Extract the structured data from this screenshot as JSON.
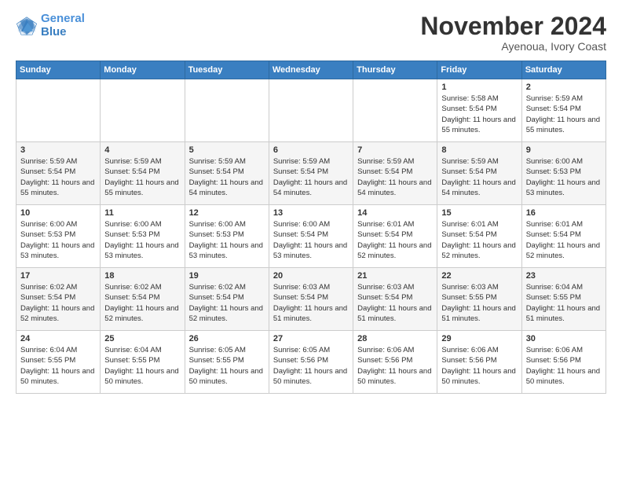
{
  "logo": {
    "line1": "General",
    "line2": "Blue"
  },
  "header": {
    "month": "November 2024",
    "location": "Ayenoua, Ivory Coast"
  },
  "weekdays": [
    "Sunday",
    "Monday",
    "Tuesday",
    "Wednesday",
    "Thursday",
    "Friday",
    "Saturday"
  ],
  "weeks": [
    [
      {
        "day": "",
        "info": ""
      },
      {
        "day": "",
        "info": ""
      },
      {
        "day": "",
        "info": ""
      },
      {
        "day": "",
        "info": ""
      },
      {
        "day": "",
        "info": ""
      },
      {
        "day": "1",
        "info": "Sunrise: 5:58 AM\nSunset: 5:54 PM\nDaylight: 11 hours and 55 minutes."
      },
      {
        "day": "2",
        "info": "Sunrise: 5:59 AM\nSunset: 5:54 PM\nDaylight: 11 hours and 55 minutes."
      }
    ],
    [
      {
        "day": "3",
        "info": "Sunrise: 5:59 AM\nSunset: 5:54 PM\nDaylight: 11 hours and 55 minutes."
      },
      {
        "day": "4",
        "info": "Sunrise: 5:59 AM\nSunset: 5:54 PM\nDaylight: 11 hours and 55 minutes."
      },
      {
        "day": "5",
        "info": "Sunrise: 5:59 AM\nSunset: 5:54 PM\nDaylight: 11 hours and 54 minutes."
      },
      {
        "day": "6",
        "info": "Sunrise: 5:59 AM\nSunset: 5:54 PM\nDaylight: 11 hours and 54 minutes."
      },
      {
        "day": "7",
        "info": "Sunrise: 5:59 AM\nSunset: 5:54 PM\nDaylight: 11 hours and 54 minutes."
      },
      {
        "day": "8",
        "info": "Sunrise: 5:59 AM\nSunset: 5:54 PM\nDaylight: 11 hours and 54 minutes."
      },
      {
        "day": "9",
        "info": "Sunrise: 6:00 AM\nSunset: 5:53 PM\nDaylight: 11 hours and 53 minutes."
      }
    ],
    [
      {
        "day": "10",
        "info": "Sunrise: 6:00 AM\nSunset: 5:53 PM\nDaylight: 11 hours and 53 minutes."
      },
      {
        "day": "11",
        "info": "Sunrise: 6:00 AM\nSunset: 5:53 PM\nDaylight: 11 hours and 53 minutes."
      },
      {
        "day": "12",
        "info": "Sunrise: 6:00 AM\nSunset: 5:53 PM\nDaylight: 11 hours and 53 minutes."
      },
      {
        "day": "13",
        "info": "Sunrise: 6:00 AM\nSunset: 5:54 PM\nDaylight: 11 hours and 53 minutes."
      },
      {
        "day": "14",
        "info": "Sunrise: 6:01 AM\nSunset: 5:54 PM\nDaylight: 11 hours and 52 minutes."
      },
      {
        "day": "15",
        "info": "Sunrise: 6:01 AM\nSunset: 5:54 PM\nDaylight: 11 hours and 52 minutes."
      },
      {
        "day": "16",
        "info": "Sunrise: 6:01 AM\nSunset: 5:54 PM\nDaylight: 11 hours and 52 minutes."
      }
    ],
    [
      {
        "day": "17",
        "info": "Sunrise: 6:02 AM\nSunset: 5:54 PM\nDaylight: 11 hours and 52 minutes."
      },
      {
        "day": "18",
        "info": "Sunrise: 6:02 AM\nSunset: 5:54 PM\nDaylight: 11 hours and 52 minutes."
      },
      {
        "day": "19",
        "info": "Sunrise: 6:02 AM\nSunset: 5:54 PM\nDaylight: 11 hours and 52 minutes."
      },
      {
        "day": "20",
        "info": "Sunrise: 6:03 AM\nSunset: 5:54 PM\nDaylight: 11 hours and 51 minutes."
      },
      {
        "day": "21",
        "info": "Sunrise: 6:03 AM\nSunset: 5:54 PM\nDaylight: 11 hours and 51 minutes."
      },
      {
        "day": "22",
        "info": "Sunrise: 6:03 AM\nSunset: 5:55 PM\nDaylight: 11 hours and 51 minutes."
      },
      {
        "day": "23",
        "info": "Sunrise: 6:04 AM\nSunset: 5:55 PM\nDaylight: 11 hours and 51 minutes."
      }
    ],
    [
      {
        "day": "24",
        "info": "Sunrise: 6:04 AM\nSunset: 5:55 PM\nDaylight: 11 hours and 50 minutes."
      },
      {
        "day": "25",
        "info": "Sunrise: 6:04 AM\nSunset: 5:55 PM\nDaylight: 11 hours and 50 minutes."
      },
      {
        "day": "26",
        "info": "Sunrise: 6:05 AM\nSunset: 5:55 PM\nDaylight: 11 hours and 50 minutes."
      },
      {
        "day": "27",
        "info": "Sunrise: 6:05 AM\nSunset: 5:56 PM\nDaylight: 11 hours and 50 minutes."
      },
      {
        "day": "28",
        "info": "Sunrise: 6:06 AM\nSunset: 5:56 PM\nDaylight: 11 hours and 50 minutes."
      },
      {
        "day": "29",
        "info": "Sunrise: 6:06 AM\nSunset: 5:56 PM\nDaylight: 11 hours and 50 minutes."
      },
      {
        "day": "30",
        "info": "Sunrise: 6:06 AM\nSunset: 5:56 PM\nDaylight: 11 hours and 50 minutes."
      }
    ]
  ]
}
